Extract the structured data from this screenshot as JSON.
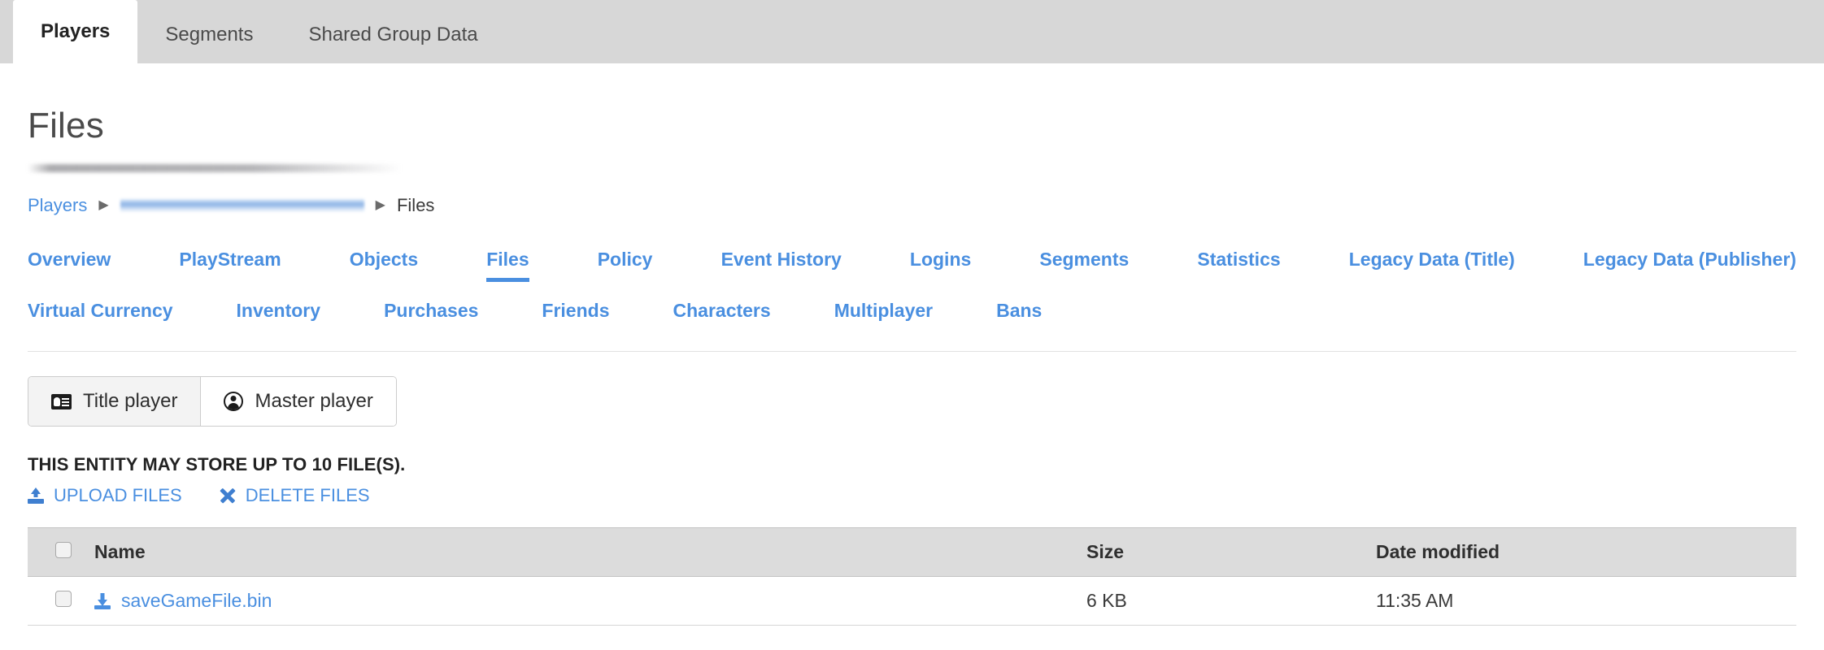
{
  "top_tabs": [
    {
      "label": "Players",
      "active": true
    },
    {
      "label": "Segments",
      "active": false
    },
    {
      "label": "Shared Group Data",
      "active": false
    }
  ],
  "page": {
    "title": "Files"
  },
  "breadcrumb": {
    "root": "Players",
    "separator": "▶",
    "middle_redacted": "",
    "current": "Files"
  },
  "subnav": {
    "row1": [
      "Overview",
      "PlayStream",
      "Objects",
      "Files",
      "Policy",
      "Event History",
      "Logins",
      "Segments",
      "Statistics",
      "Legacy Data (Title)",
      "Legacy Data (Publisher)"
    ],
    "row2": [
      "Virtual Currency",
      "Inventory",
      "Purchases",
      "Friends",
      "Characters",
      "Multiplayer",
      "Bans"
    ],
    "active": "Files"
  },
  "entity_toggle": {
    "title_player": {
      "label": "Title player",
      "icon": "id-card-icon",
      "selected": true
    },
    "master_player": {
      "label": "Master player",
      "icon": "user-circle-icon",
      "selected": false
    }
  },
  "files_section": {
    "store_note": "THIS ENTITY MAY STORE UP TO 10 FILE(S).",
    "upload_label": "UPLOAD FILES",
    "upload_icon": "upload-icon",
    "delete_label": "DELETE FILES",
    "delete_icon": "close-x-icon",
    "columns": [
      "Name",
      "Size",
      "Date modified"
    ],
    "rows": [
      {
        "name": "saveGameFile.bin",
        "name_icon": "download-icon",
        "size": "6 KB",
        "date_modified": "11:35 AM",
        "checked": false
      }
    ]
  },
  "colors": {
    "link_blue": "#4a8fe0",
    "tabstrip_gray": "#d7d7d7",
    "table_header_gray": "#dcdcdc"
  }
}
